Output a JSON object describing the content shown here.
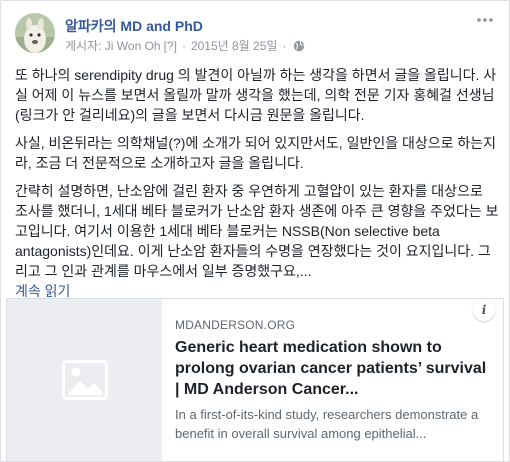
{
  "post": {
    "page_name": "알파카의 MD and PhD",
    "posted_by": "게시자: Ji Won Oh",
    "help_marker": "[?]",
    "separator": "·",
    "date": "2015년 8월 25일",
    "privacy_icon": "globe-icon",
    "more_icon": "more-options-icon",
    "paragraphs": [
      "또 하나의 serendipity drug 의 발견이 아닐까 하는 생각을 하면서 글을 올립니다. 사실 어제 이 뉴스를 보면서 올릴까 말까 생각을 했는데, 의학 전문 기자 홍혜걸 선생님(링크가 안 걸리네요)의 글을 보면서 다시금 원문을 올립니다.",
      "사실, 비온뒤라는 의학채널(?)에 소개가 되어 있지만서도, 일반인을 대상으로 하는지라, 조금 더 전문적으로 소개하고자 글을 올립니다."
    ],
    "paragraph3": "간략히 설명하면, 난소암에 걸린 환자 중 우연하게 고혈압이 있는 환자를 대상으로 조사를 했더니, 1세대 베타 블로커가 난소암 환자 생존에 아주 큰 영향을 주었다는 보고입니다. 여기서 이용한 1세대 베타 블로커는 NSSB(Non selective beta antagonists)인데요. 이게 난소암 환자들의 수명을 연장했다는 것이 요지입니다. 그리고 그 인과 관계를 마우스에서 일부 증명했구요,...",
    "see_more": "계속 읽기"
  },
  "link_preview": {
    "domain": "MDANDERSON.ORG",
    "title": "Generic heart medication shown to prolong ovarian cancer patients’ survival | MD Anderson Cancer...",
    "description": "In a first-of-its-kind study, researchers demonstrate a benefit in overall survival among epithelial...",
    "thumbnail_icon": "image-placeholder-icon",
    "info_label": "i"
  },
  "colors": {
    "link_blue": "#365899",
    "meta_gray": "#90949c",
    "thumb_bg": "#ebedf0"
  }
}
